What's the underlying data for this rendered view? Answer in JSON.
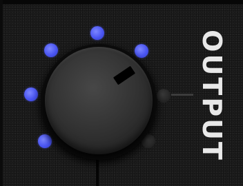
{
  "label": {
    "text": "OUTPUT"
  },
  "knob": {
    "name": "output-knob"
  },
  "indicators": {
    "active_color": "#4a55f2",
    "inactive_color": "#2a2a2a",
    "lit_count": 5,
    "total_count": 7
  }
}
